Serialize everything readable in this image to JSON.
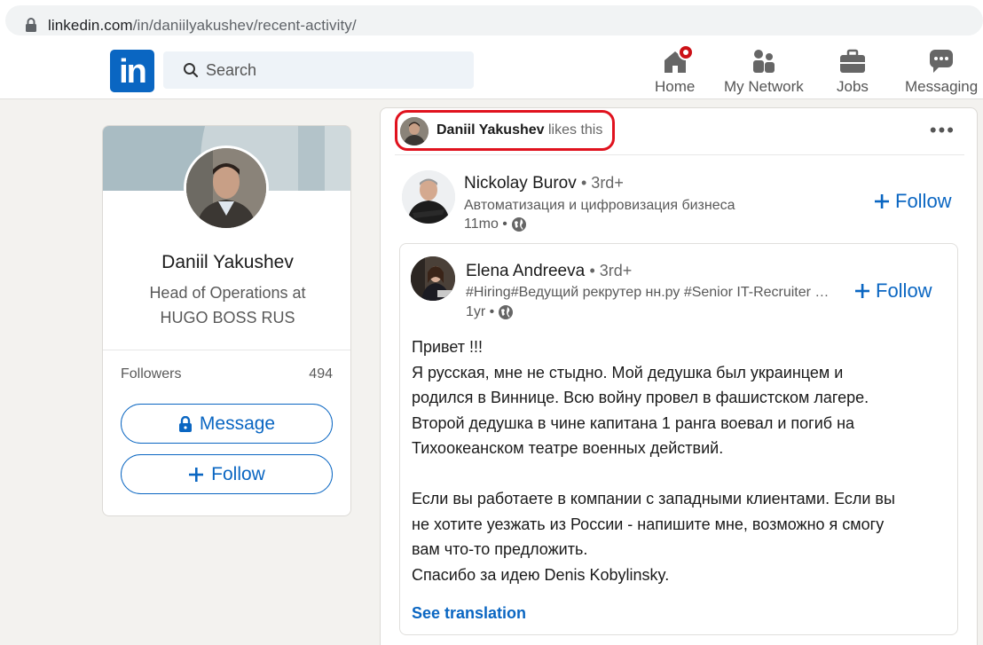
{
  "browser": {
    "url_host": "linkedin.com",
    "url_path": "/in/daniilyakushev/recent-activity/"
  },
  "nav": {
    "logo_text": "in",
    "search_placeholder": "Search",
    "items": [
      {
        "label": "Home",
        "icon": "home-icon"
      },
      {
        "label": "My Network",
        "icon": "my-network-icon"
      },
      {
        "label": "Jobs",
        "icon": "briefcase-icon"
      },
      {
        "label": "Messaging",
        "icon": "messaging-icon"
      }
    ],
    "home_has_notification": true
  },
  "profile": {
    "name": "Daniil Yakushev",
    "headline": "Head of Operations at HUGO BOSS RUS",
    "followers_label": "Followers",
    "followers_count": "494",
    "message_label": "Message",
    "follow_label": "Follow"
  },
  "feed": {
    "activity_name": "Daniil Yakushev",
    "activity_action": "likes this",
    "author": {
      "name": "Nickolay Burov",
      "degree": "• 3rd+",
      "subtitle": "Автоматизация и цифровизация бизнеса",
      "time": "11mo •",
      "follow_label": "Follow"
    },
    "shared": {
      "name": "Elena Andreeva",
      "degree": "• 3rd+",
      "subtitle": "#Hiring#Ведущий рекрутер нн.ру #Senior IT-Recruiter #Sourcer",
      "time": "1yr •",
      "follow_label": "Follow",
      "text": "Привет !!!\nЯ русская, мне не стыдно. Мой дедушка был украинцем и\nродился в Виннице. Всю войну провел в фашистском лагере.\nВторой дедушка в чине капитана 1 ранга воевал и погиб на\nТихоокеанском театре военных действий.\n\nЕсли вы работаете в компании с западными клиентами. Если вы\n не хотите уезжать из России - напишите мне, возможно я смогу\nвам что-то предложить.\nСпасибо за идею Denis Kobylinsky.",
      "see_translation": "See translation"
    }
  },
  "colors": {
    "brand": "#0a66c2",
    "highlight": "#e0121e",
    "background": "#f3f2ef"
  }
}
